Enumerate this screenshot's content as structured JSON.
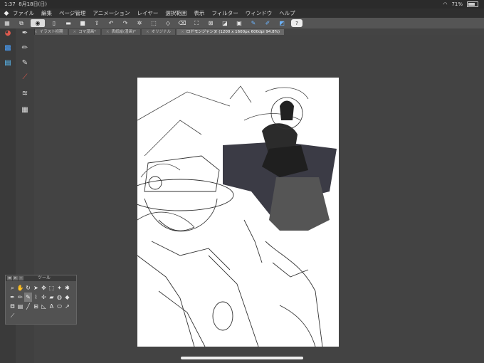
{
  "status": {
    "time": "1:37",
    "date": "8月18日(日)",
    "battery": "71%"
  },
  "menu": {
    "items": [
      "ファイル",
      "編集",
      "ページ管理",
      "アニメーション",
      "レイヤー",
      "選択範囲",
      "表示",
      "フィルター",
      "ウィンドウ",
      "ヘルプ"
    ]
  },
  "toolbar": {
    "help_label": "?"
  },
  "tabs": {
    "nav": "«",
    "items": [
      {
        "label": "イラスト初期"
      },
      {
        "label": "コマ漫画*"
      },
      {
        "label": "表紙絵(漫画)*"
      },
      {
        "label": "オリジナル"
      },
      {
        "label": "ロドモンジャンヌ (1200 x 1600px 600dpi 94.8%)"
      }
    ]
  },
  "tool_palette": {
    "title": "ツール",
    "tools": [
      "zoom-icon",
      "hand-icon",
      "rotate-icon",
      "operation-icon",
      "move-layer-icon",
      "selection-icon",
      "auto-select-icon",
      "eyedropper-icon",
      "pen-icon",
      "pencil-icon",
      "brush-icon",
      "airbrush-icon",
      "decoration-icon",
      "eraser-icon",
      "blend-icon",
      "fill-icon",
      "gradient-icon",
      "figure-icon",
      "frame-icon",
      "ruler-icon",
      "text-icon",
      "balloon-icon",
      "line-correction-icon",
      "extra-icon"
    ]
  },
  "colors": {
    "accent": "#6db5ff",
    "bg": "#3c3c3c",
    "canvas": "#ffffff"
  }
}
